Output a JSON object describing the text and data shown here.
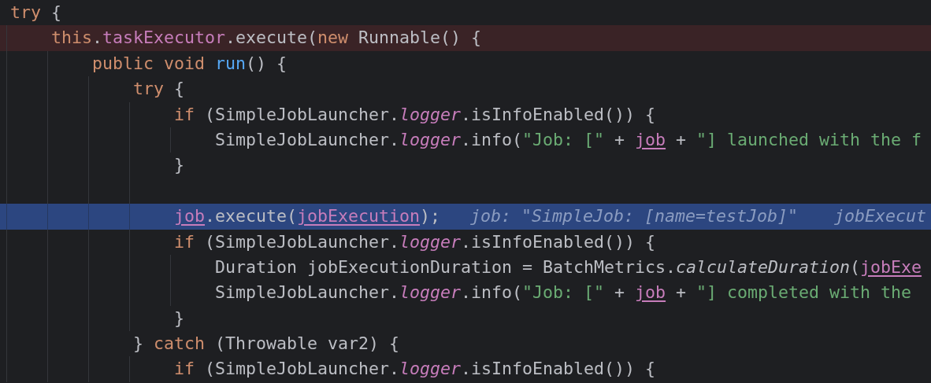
{
  "editor": {
    "lines": [
      {
        "kind": "code",
        "tokens": [
          {
            "text": "try",
            "kind": "keyword"
          },
          {
            "text": " {",
            "kind": "plain"
          }
        ],
        "children": [
          {
            "kind": "breakpoint",
            "tokens": [
              {
                "text": "this",
                "kind": "keyword"
              },
              {
                "text": ".",
                "kind": "plain"
              },
              {
                "text": "taskExecutor",
                "kind": "field"
              },
              {
                "text": ".execute(",
                "kind": "plain"
              },
              {
                "text": "new",
                "kind": "keyword"
              },
              {
                "text": " Runnable() {",
                "kind": "plain"
              }
            ],
            "children": [
              {
                "kind": "code",
                "tokens": [
                  {
                    "text": "public void ",
                    "kind": "keyword"
                  },
                  {
                    "text": "run",
                    "kind": "declaration"
                  },
                  {
                    "text": "() {",
                    "kind": "plain"
                  }
                ],
                "children": [
                  {
                    "kind": "code",
                    "tokens": [
                      {
                        "text": "try",
                        "kind": "keyword"
                      },
                      {
                        "text": " {",
                        "kind": "plain"
                      }
                    ],
                    "children": [
                      {
                        "kind": "code",
                        "tokens": [
                          {
                            "text": "if",
                            "kind": "keyword"
                          },
                          {
                            "text": " (SimpleJobLauncher.",
                            "kind": "plain"
                          },
                          {
                            "text": "logger",
                            "kind": "static-field"
                          },
                          {
                            "text": ".isInfoEnabled()) {",
                            "kind": "plain"
                          }
                        ],
                        "children": [
                          {
                            "kind": "code",
                            "tokens": [
                              {
                                "text": "SimpleJobLauncher.",
                                "kind": "plain"
                              },
                              {
                                "text": "logger",
                                "kind": "static-field"
                              },
                              {
                                "text": ".info(",
                                "kind": "plain"
                              },
                              {
                                "text": "\"Job: [\"",
                                "kind": "string"
                              },
                              {
                                "text": " + ",
                                "kind": "plain"
                              },
                              {
                                "text": "job",
                                "kind": "captured"
                              },
                              {
                                "text": " + ",
                                "kind": "plain"
                              },
                              {
                                "text": "\"] launched with the f",
                                "kind": "string"
                              }
                            ]
                          }
                        ]
                      },
                      {
                        "kind": "code",
                        "tokens": [
                          {
                            "text": "}",
                            "kind": "plain"
                          }
                        ]
                      },
                      {
                        "kind": "blank"
                      },
                      {
                        "kind": "execution",
                        "tokens": [
                          {
                            "text": "job",
                            "kind": "captured"
                          },
                          {
                            "text": ".execute(",
                            "kind": "plain"
                          },
                          {
                            "text": "jobExecution",
                            "kind": "captured"
                          },
                          {
                            "text": ");",
                            "kind": "plain"
                          }
                        ],
                        "hints": [
                          "job: \"SimpleJob: [name=testJob]\"",
                          "jobExecut"
                        ]
                      },
                      {
                        "kind": "code",
                        "tokens": [
                          {
                            "text": "if",
                            "kind": "keyword"
                          },
                          {
                            "text": " (SimpleJobLauncher.",
                            "kind": "plain"
                          },
                          {
                            "text": "logger",
                            "kind": "static-field"
                          },
                          {
                            "text": ".isInfoEnabled()) {",
                            "kind": "plain"
                          }
                        ],
                        "children": [
                          {
                            "kind": "code",
                            "tokens": [
                              {
                                "text": "Duration jobExecutionDuration = BatchMetrics.",
                                "kind": "plain"
                              },
                              {
                                "text": "calculateDuration",
                                "kind": "static-method"
                              },
                              {
                                "text": "(",
                                "kind": "plain"
                              },
                              {
                                "text": "jobExe",
                                "kind": "captured"
                              }
                            ]
                          },
                          {
                            "kind": "code",
                            "tokens": [
                              {
                                "text": "SimpleJobLauncher.",
                                "kind": "plain"
                              },
                              {
                                "text": "logger",
                                "kind": "static-field"
                              },
                              {
                                "text": ".info(",
                                "kind": "plain"
                              },
                              {
                                "text": "\"Job: [\"",
                                "kind": "string"
                              },
                              {
                                "text": " + ",
                                "kind": "plain"
                              },
                              {
                                "text": "job",
                                "kind": "captured"
                              },
                              {
                                "text": " + ",
                                "kind": "plain"
                              },
                              {
                                "text": "\"] completed with the",
                                "kind": "string"
                              }
                            ]
                          }
                        ]
                      },
                      {
                        "kind": "code",
                        "tokens": [
                          {
                            "text": "}",
                            "kind": "plain"
                          }
                        ]
                      }
                    ]
                  },
                  {
                    "kind": "code",
                    "tokens": [
                      {
                        "text": "} ",
                        "kind": "plain"
                      },
                      {
                        "text": "catch",
                        "kind": "keyword"
                      },
                      {
                        "text": " (Throwable var2) {",
                        "kind": "plain"
                      }
                    ],
                    "children": [
                      {
                        "kind": "code",
                        "tokens": [
                          {
                            "text": "if",
                            "kind": "keyword"
                          },
                          {
                            "text": " (SimpleJobLauncher.",
                            "kind": "plain"
                          },
                          {
                            "text": "logger",
                            "kind": "static-field"
                          },
                          {
                            "text": ".isInfoEnabled()) {",
                            "kind": "plain"
                          }
                        ]
                      }
                    ]
                  }
                ]
              }
            ]
          }
        ]
      }
    ]
  }
}
